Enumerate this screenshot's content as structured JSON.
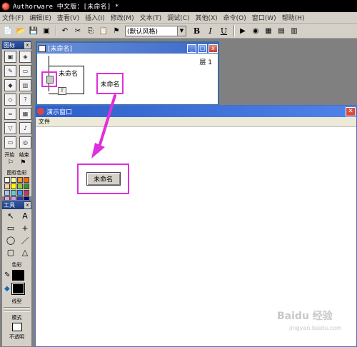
{
  "app": {
    "title": "Authorware 中文版：[未命名] *"
  },
  "menu": [
    "文件(F)",
    "编辑(E)",
    "查看(V)",
    "插入(I)",
    "修改(M)",
    "文本(T)",
    "调试(C)",
    "其他(X)",
    "命令(O)",
    "窗口(W)",
    "帮助(H)"
  ],
  "toolbar": {
    "style_value": "(默认风格)",
    "bold": "B",
    "italic": "I",
    "underline": "U"
  },
  "icons_panel": {
    "title": "图标",
    "start_label": "开始",
    "end_label": "结束",
    "color_label": "图标色彩",
    "colors": [
      "#ffffff",
      "#ffff99",
      "#ff9933",
      "#ff6600",
      "#ffcc99",
      "#ffff00",
      "#99cc33",
      "#339933",
      "#99ccff",
      "#66cccc",
      "#3399ff",
      "#cc3366",
      "#ff99cc",
      "#cc99ff",
      "#3333cc",
      "#000080"
    ]
  },
  "tools_panel": {
    "title": "工具",
    "color_label": "色彩",
    "line_label": "线型",
    "mode_label": "模式",
    "fill_label": "不透明"
  },
  "flow_window": {
    "title": "[未命名]",
    "layer": "层 1",
    "icon_name": "未命名",
    "callout_text": "未命名",
    "bt_label": "T"
  },
  "presentation": {
    "title": "演示窗口",
    "menu_file": "文件",
    "button_label": "未命名"
  },
  "watermark": {
    "text": "Baidu 经验",
    "sub": "jingyan.baidu.com"
  }
}
